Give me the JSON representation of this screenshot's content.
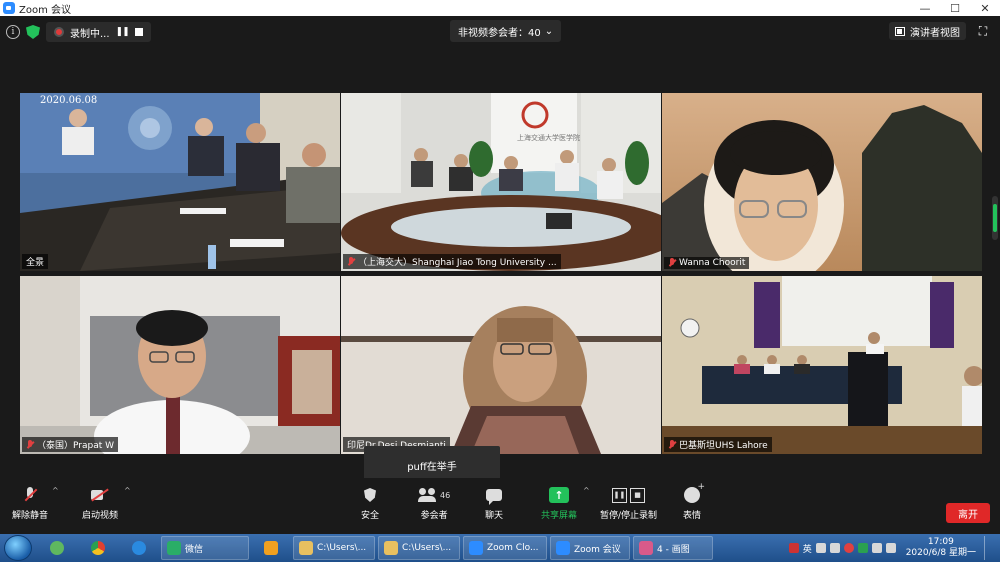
{
  "window": {
    "title": "Zoom 会议",
    "minimize": "—",
    "maximize": "☐",
    "close": "✕"
  },
  "recording": {
    "label": "录制中..."
  },
  "participants_pill": "非视频参会者：40",
  "speaker_view_label": "演讲者视图",
  "tiles": [
    {
      "name": "全景",
      "muted": false,
      "active": true
    },
    {
      "name": "（上海交大）Shanghai Jiao Tong University ...",
      "muted": true,
      "active": false
    },
    {
      "name": "Wanna Choorit",
      "muted": true,
      "active": false
    },
    {
      "name": "（泰国）Prapat W",
      "muted": true,
      "active": false
    },
    {
      "name": "印尼Dr.Desi Desmianti",
      "muted": false,
      "active": false
    },
    {
      "name": "巴基斯坦UHS Lahore",
      "muted": true,
      "active": false
    }
  ],
  "tile_overlay_text": {
    "date_stamp": "2020.06.08",
    "sign_text": "上海交通大学医学院"
  },
  "raise_hand_tooltip": "puff在举手",
  "controls": {
    "unmute": "解除静音",
    "start_video": "启动视频",
    "security": "安全",
    "participants": "参会者",
    "participants_count": "46",
    "chat": "聊天",
    "share_screen": "共享屏幕",
    "pause_stop_recording": "暂停/停止录制",
    "reactions": "表情",
    "leave": "离开"
  },
  "taskbar": {
    "items": [
      {
        "label": "微信",
        "color": "#2aae67"
      },
      {
        "label": "",
        "color": "#f0a020"
      },
      {
        "label": "C:\\Users\\...",
        "color": "#e8c060"
      },
      {
        "label": "C:\\Users\\...",
        "color": "#e8c060"
      },
      {
        "label": "Zoom Clo...",
        "color": "#2d8cff"
      },
      {
        "label": "Zoom 会议",
        "color": "#2d8cff"
      },
      {
        "label": "4 - 画图",
        "color": "#d85a8a"
      }
    ],
    "ime": "英",
    "time": "17:09",
    "date": "2020/6/8 星期一"
  }
}
